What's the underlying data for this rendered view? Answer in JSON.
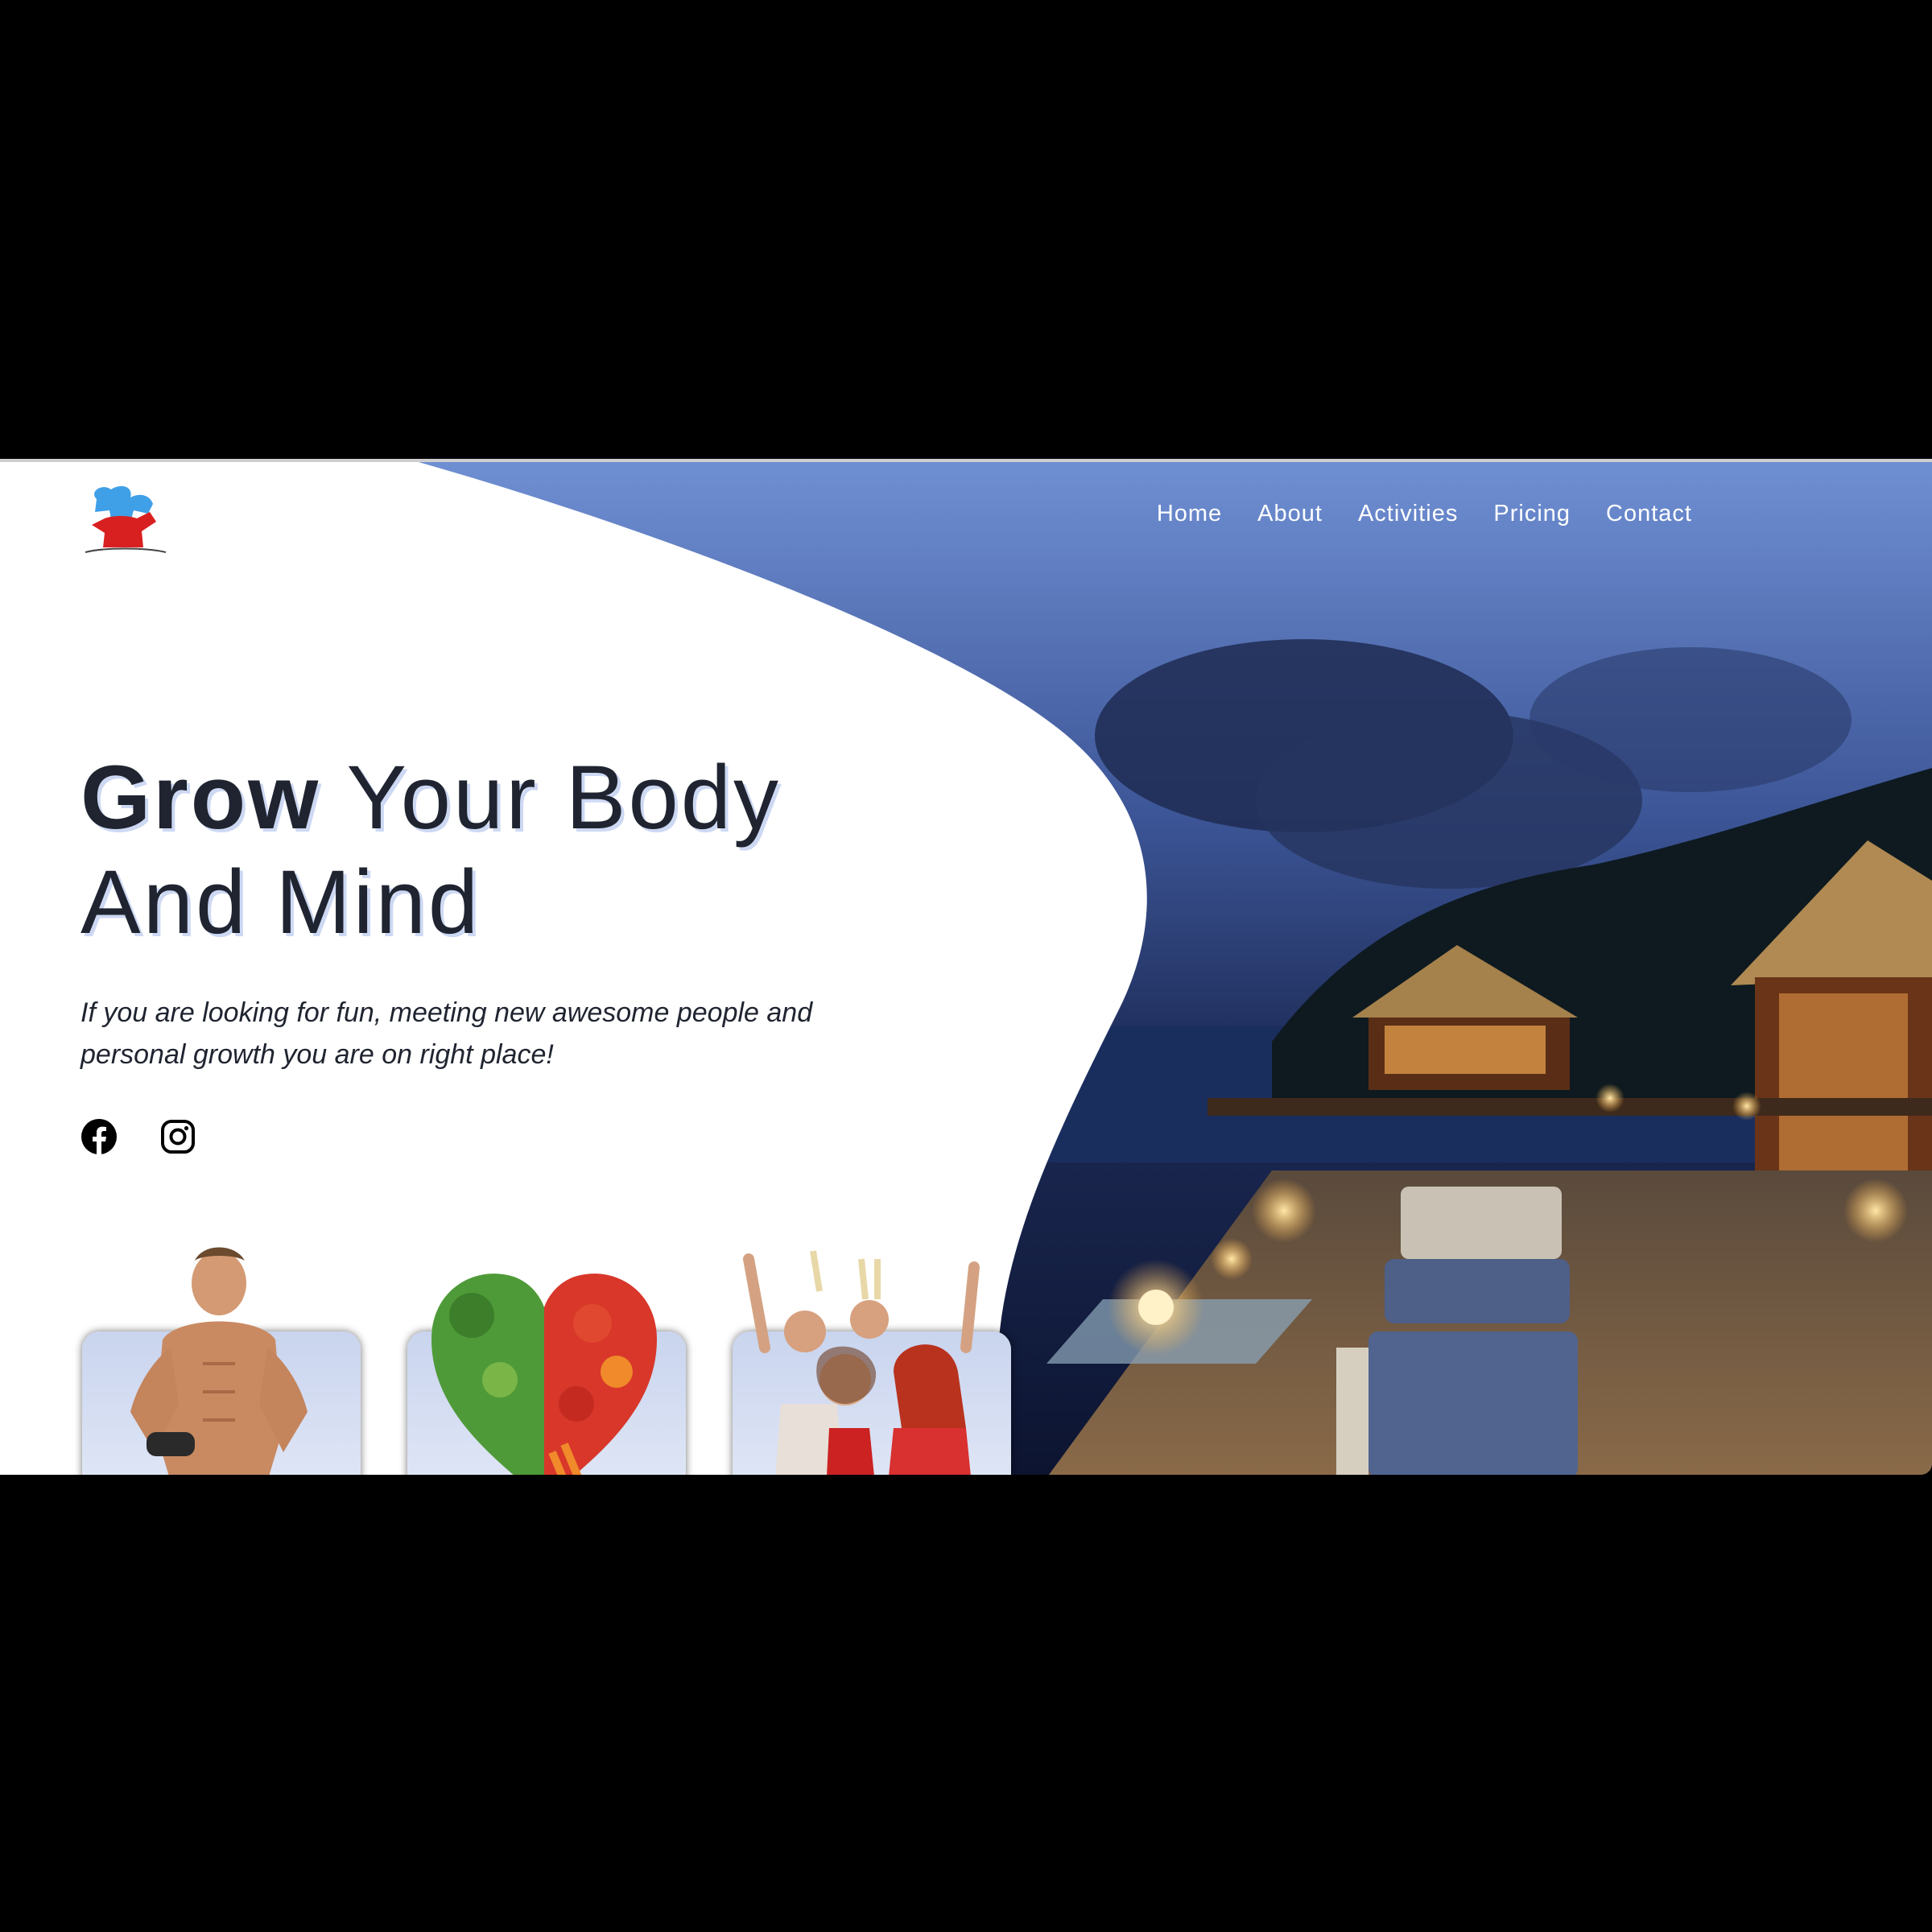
{
  "nav": {
    "items": [
      {
        "label": "Home"
      },
      {
        "label": "About"
      },
      {
        "label": "Activities"
      },
      {
        "label": "Pricing"
      },
      {
        "label": "Contact"
      }
    ]
  },
  "hero": {
    "headline_strong": "Grow",
    "headline_rest": " Your Body",
    "headline_line2": "And Mind",
    "tagline": "If you are looking for fun, meeting new awesome people and personal growth you are on right place!"
  },
  "social": {
    "icons": [
      "facebook-icon",
      "instagram-icon"
    ]
  },
  "cards": [
    {
      "icon": "fitness-man-image"
    },
    {
      "icon": "vegetable-heart-image"
    },
    {
      "icon": "party-people-image"
    }
  ],
  "colors": {
    "text": "#1f2430",
    "nav_text": "#ffffff",
    "logo_blue": "#3fa0e8",
    "logo_red": "#d92020",
    "sky": "#5f7fc6",
    "night": "#0e1a3d"
  }
}
